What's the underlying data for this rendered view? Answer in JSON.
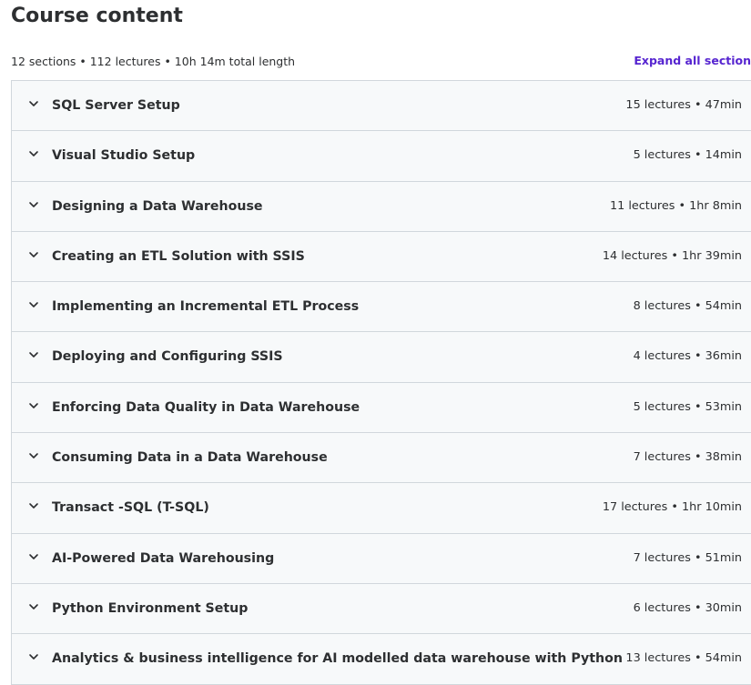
{
  "header": {
    "title": "Course content",
    "summary": "12 sections • 112 lectures • 10h 14m total length",
    "expand_label": "Expand all section"
  },
  "sections": [
    {
      "title": "SQL Server Setup",
      "meta": "15 lectures • 47min"
    },
    {
      "title": "Visual Studio Setup",
      "meta": "5 lectures • 14min"
    },
    {
      "title": "Designing a Data Warehouse",
      "meta": "11 lectures • 1hr 8min"
    },
    {
      "title": "Creating an ETL Solution with SSIS",
      "meta": "14 lectures • 1hr 39min"
    },
    {
      "title": "Implementing an Incremental ETL Process",
      "meta": "8 lectures • 54min"
    },
    {
      "title": "Deploying and Configuring SSIS",
      "meta": "4 lectures • 36min"
    },
    {
      "title": "Enforcing Data Quality in Data Warehouse",
      "meta": "5 lectures • 53min"
    },
    {
      "title": "Consuming Data in a Data Warehouse",
      "meta": "7 lectures • 38min"
    },
    {
      "title": "Transact -SQL (T-SQL)",
      "meta": "17 lectures • 1hr 10min"
    },
    {
      "title": "AI-Powered Data Warehousing",
      "meta": "7 lectures • 51min"
    },
    {
      "title": "Python Environment Setup",
      "meta": "6 lectures • 30min"
    },
    {
      "title": "Analytics & business intelligence for AI modelled data warehouse with Python",
      "meta": "13 lectures • 54min"
    }
  ],
  "icons": {
    "section_toggle": "chevron-down-icon"
  },
  "colors": {
    "text": "#2d2f31",
    "accent": "#5624d0",
    "section_bg": "#f7f9fa",
    "border": "#d1d7dc"
  }
}
